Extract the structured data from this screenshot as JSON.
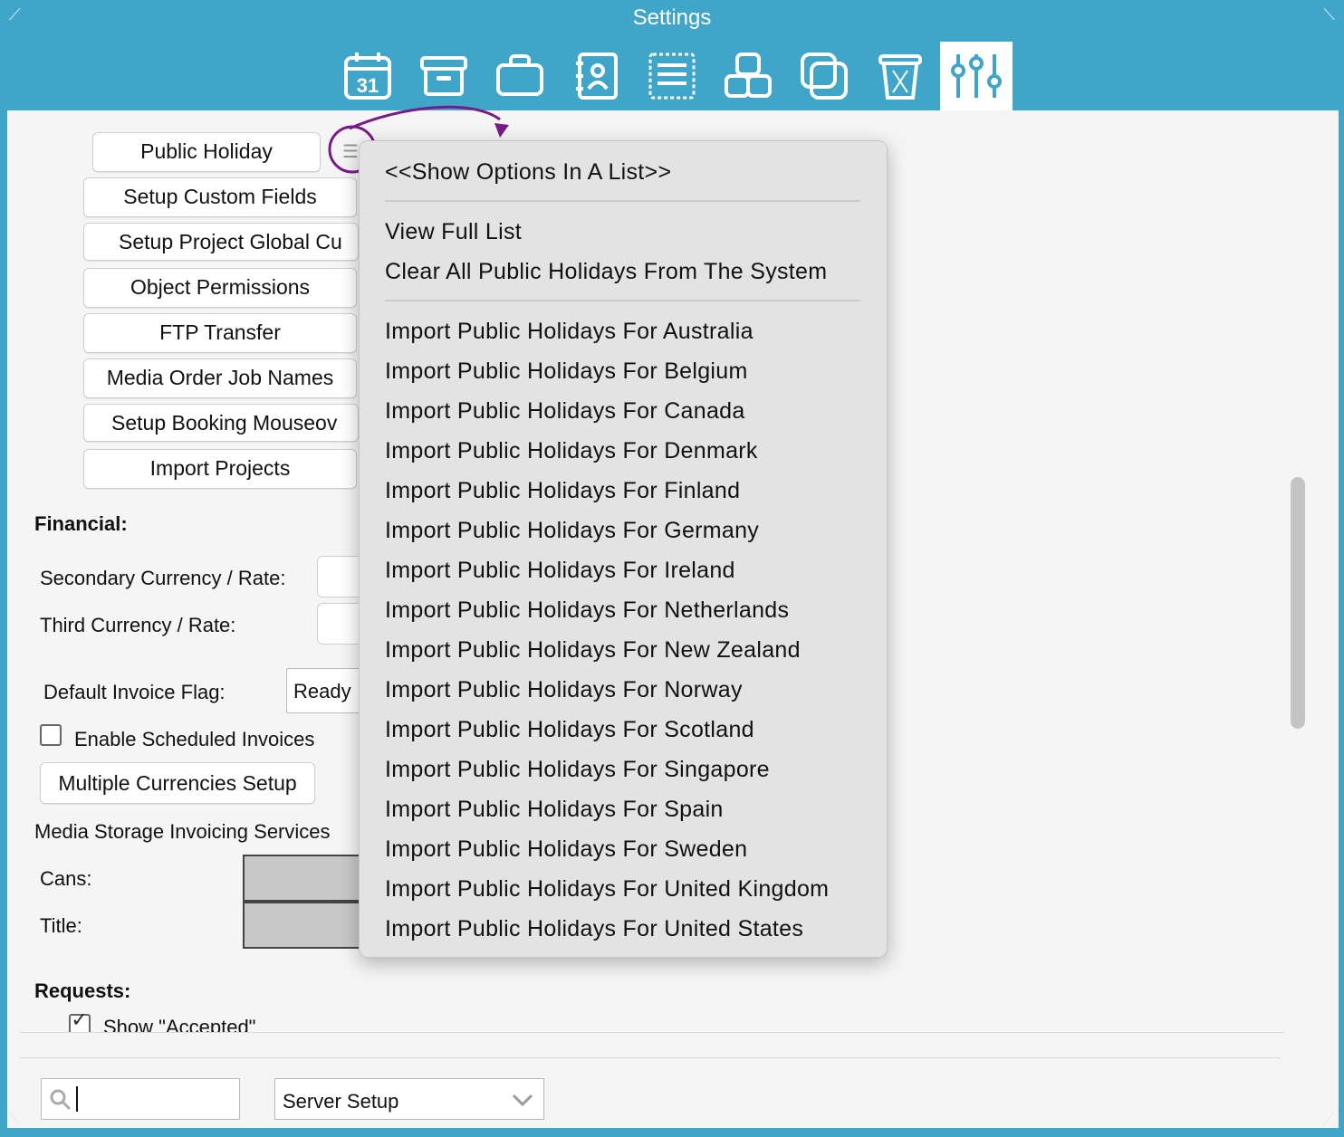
{
  "window": {
    "title": "Settings"
  },
  "toolbar": {
    "icons": [
      {
        "name": "calendar-icon",
        "text": "31"
      },
      {
        "name": "archive-box-icon"
      },
      {
        "name": "briefcase-icon"
      },
      {
        "name": "contacts-book-icon"
      },
      {
        "name": "list-document-icon"
      },
      {
        "name": "resources-blocks-icon"
      },
      {
        "name": "copy-stack-icon"
      },
      {
        "name": "trash-icon"
      },
      {
        "name": "settings-sliders-icon",
        "active": true
      }
    ]
  },
  "buttons": {
    "public_holiday": "Public Holiday",
    "setup_custom_fields": "Setup Custom Fields",
    "setup_project_global": "Setup Project Global Cu",
    "object_permissions": "Object Permissions",
    "ftp_transfer": "FTP Transfer",
    "media_order_job_names": "Media Order Job Names",
    "setup_booking_mouseover": "Setup Booking Mouseov",
    "import_projects": "Import Projects",
    "multiple_currencies_setup": "Multiple Currencies Setup"
  },
  "financial": {
    "heading": "Financial:",
    "secondary_currency_label": "Secondary Currency / Rate:",
    "third_currency_label": "Third Currency / Rate:",
    "default_invoice_flag_label": "Default Invoice Flag:",
    "default_invoice_flag_value": "Ready",
    "enable_scheduled_invoices_label": "Enable Scheduled Invoices",
    "enable_scheduled_invoices_checked": false,
    "media_storage_label": "Media Storage Invoicing Services",
    "cans_label": "Cans:",
    "title_label": "Title:"
  },
  "requests": {
    "heading": "Requests:",
    "show_accepted_label": "Show \"Accepted\"",
    "show_accepted_checked": true
  },
  "menu": {
    "show_options": "<<Show Options In A List>>",
    "view_full_list": "View Full List",
    "clear_all": "Clear All Public Holidays From The System",
    "imports": [
      "Import Public Holidays For Australia",
      "Import Public Holidays For Belgium",
      "Import Public Holidays For Canada",
      "Import Public Holidays For Denmark",
      "Import Public Holidays For Finland",
      "Import Public Holidays For Germany",
      "Import Public Holidays For Ireland",
      "Import Public Holidays For Netherlands",
      "Import Public Holidays For New Zealand",
      "Import Public Holidays For Norway",
      "Import Public Holidays For Scotland",
      "Import Public Holidays For Singapore",
      "Import Public Holidays For Spain",
      "Import Public Holidays For Sweden",
      "Import Public Holidays For United Kingdom",
      "Import Public Holidays For United States"
    ]
  },
  "footer": {
    "search_value": "",
    "select_value": "Server Setup"
  },
  "colors": {
    "titlebar": "#40a6c9",
    "annotation": "#7a1a8a"
  }
}
